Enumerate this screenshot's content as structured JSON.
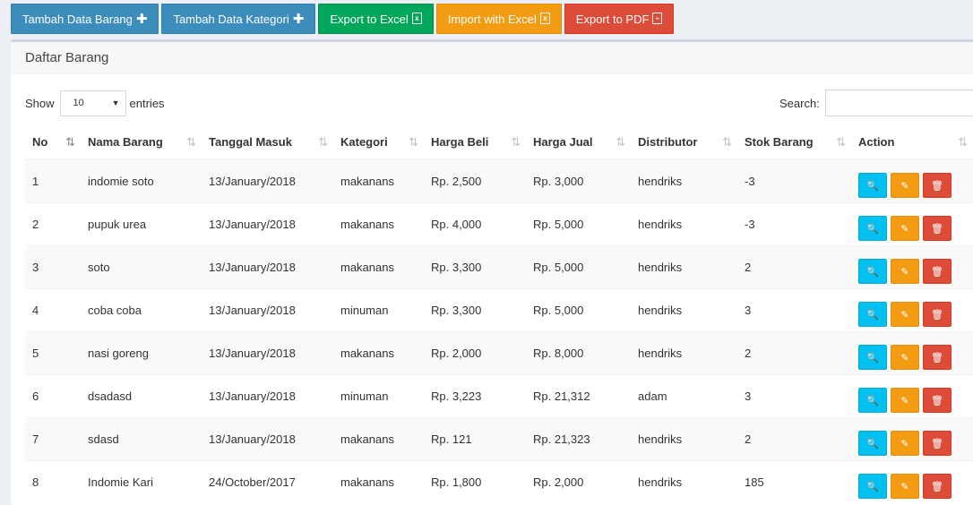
{
  "toolbar": {
    "add_item": "Tambah Data Barang",
    "add_category": "Tambah Data Kategori",
    "export_excel": "Export to Excel",
    "import_excel": "Import with Excel",
    "export_pdf": "Export to PDF"
  },
  "panel": {
    "title": "Daftar Barang"
  },
  "controls": {
    "show_label": "Show",
    "entries_value": "10",
    "entries_label": "entries",
    "search_label": "Search:",
    "search_value": ""
  },
  "table": {
    "columns": [
      "No",
      "Nama Barang",
      "Tanggal Masuk",
      "Kategori",
      "Harga Beli",
      "Harga Jual",
      "Distributor",
      "Stok Barang",
      "Action"
    ],
    "rows": [
      [
        "1",
        "indomie soto",
        "13/January/2018",
        "makanans",
        "Rp. 2,500",
        "Rp. 3,000",
        "hendriks",
        "-3"
      ],
      [
        "2",
        "pupuk urea",
        "13/January/2018",
        "makanans",
        "Rp. 4,000",
        "Rp. 5,000",
        "hendriks",
        "-3"
      ],
      [
        "3",
        "soto",
        "13/January/2018",
        "makanans",
        "Rp. 3,300",
        "Rp. 5,000",
        "hendriks",
        "2"
      ],
      [
        "4",
        "coba coba",
        "13/January/2018",
        "minuman",
        "Rp. 3,300",
        "Rp. 5,000",
        "hendriks",
        "3"
      ],
      [
        "5",
        "nasi goreng",
        "13/January/2018",
        "makanans",
        "Rp. 2,000",
        "Rp. 8,000",
        "hendriks",
        "2"
      ],
      [
        "6",
        "dsadasd",
        "13/January/2018",
        "minuman",
        "Rp. 3,223",
        "Rp. 21,312",
        "adam",
        "3"
      ],
      [
        "7",
        "sdasd",
        "13/January/2018",
        "makanans",
        "Rp. 121",
        "Rp. 21,323",
        "hendriks",
        "2"
      ],
      [
        "8",
        "Indomie Kari",
        "24/October/2017",
        "makanans",
        "Rp. 1,800",
        "Rp. 2,000",
        "hendriks",
        "185"
      ]
    ]
  },
  "icons": {
    "plus": "plus-icon",
    "excel": "file-excel-icon",
    "pdf": "file-pdf-icon",
    "view": "search-icon",
    "edit": "edit-icon",
    "delete": "trash-icon",
    "sort": "sort-icon",
    "sort_active": "sort-amount-asc-icon"
  },
  "colors": {
    "primary": "#3c8dbc",
    "success": "#00a65a",
    "warning": "#f39c12",
    "danger": "#dd4b39",
    "info": "#00c0ef"
  }
}
